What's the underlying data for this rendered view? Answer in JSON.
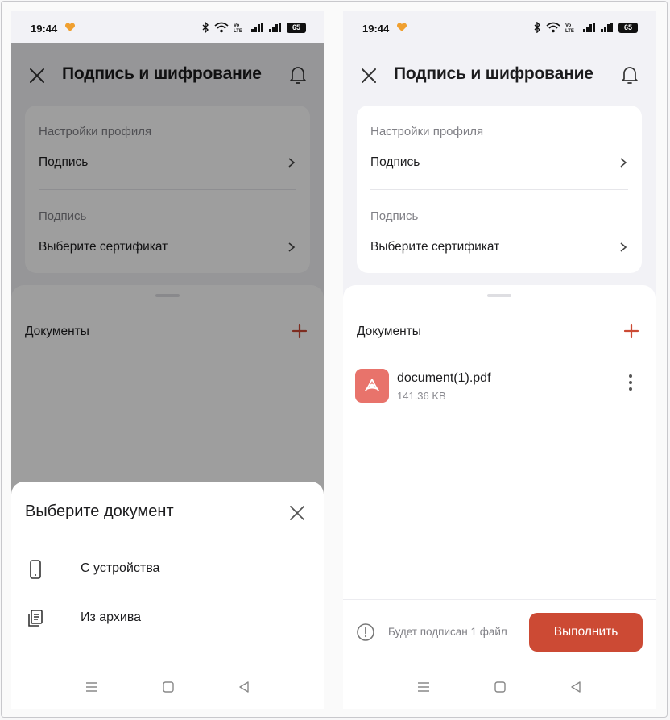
{
  "status_bar": {
    "time": "19:44",
    "network_label": "Vo\nLTE",
    "battery": "65"
  },
  "header": {
    "title": "Подпись и шифрование"
  },
  "profile_settings": {
    "caption": "Настройки профиля",
    "signature_row": "Подпись"
  },
  "signature_section": {
    "caption": "Подпись",
    "certificate_row": "Выберите сертификат"
  },
  "documents": {
    "title": "Документы",
    "items": [
      {
        "name": "document(1).pdf",
        "size": "141.36 KB"
      }
    ]
  },
  "bottom": {
    "hint": "Будет подписан 1 файл",
    "action_label": "Выполнить"
  },
  "choose_document_sheet": {
    "title": "Выберите документ",
    "options": [
      {
        "label": "С устройства",
        "icon": "phone-icon"
      },
      {
        "label": "Из архива",
        "icon": "archive-icon"
      }
    ]
  },
  "colors": {
    "accent": "#cc4a34",
    "pdf_tile": "#e8736b",
    "background": "#f2f2f6"
  }
}
